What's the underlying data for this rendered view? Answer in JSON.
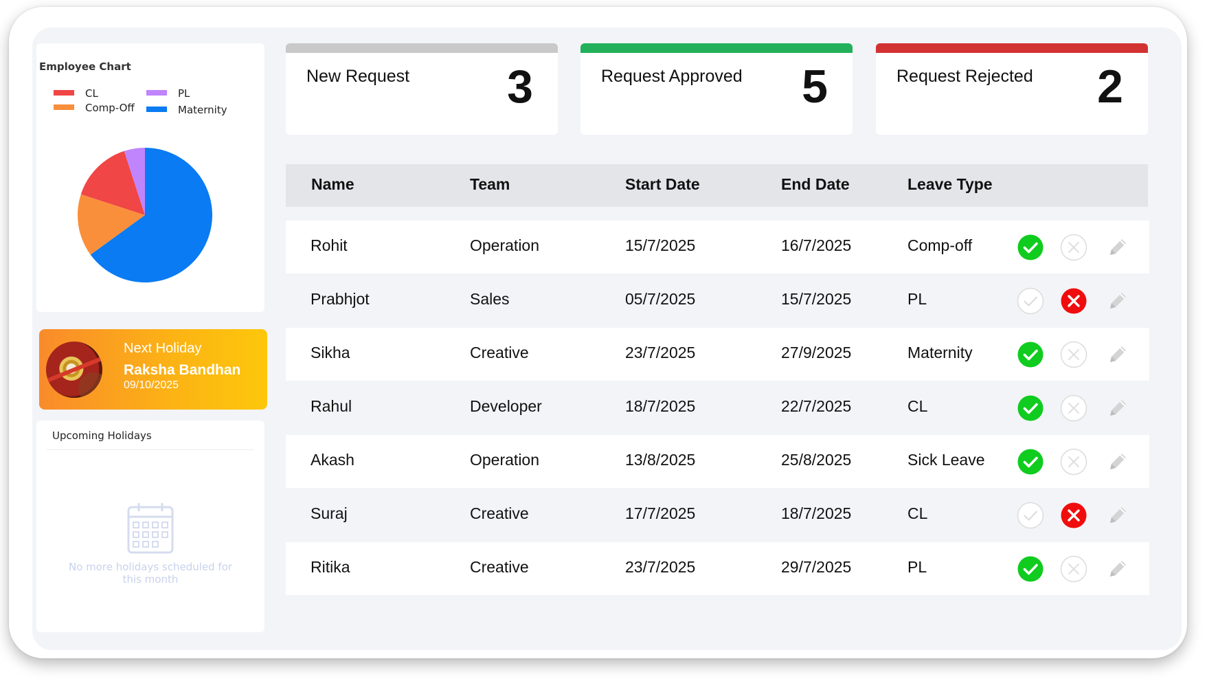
{
  "chart_card": {
    "title": "Employee Chart",
    "legend": [
      {
        "label": "CL",
        "color": "#f04646"
      },
      {
        "label": "PL",
        "color": "#c084fc"
      },
      {
        "label": "Comp-Off",
        "color": "#fa8f3b"
      },
      {
        "label": "Maternity",
        "color": "#0a7bf2"
      }
    ]
  },
  "chart_data": {
    "type": "pie",
    "title": "Employee Chart",
    "slices": [
      {
        "label": "Maternity",
        "value": 65,
        "color": "#0a7bf2"
      },
      {
        "label": "Comp-Off",
        "value": 15,
        "color": "#fa8f3b"
      },
      {
        "label": "CL",
        "value": 15,
        "color": "#f04646"
      },
      {
        "label": "PL",
        "value": 5,
        "color": "#c084fc"
      }
    ],
    "legend_position": "top"
  },
  "holiday": {
    "label": "Next Holiday",
    "name": "Raksha Bandhan",
    "date": "09/10/2025"
  },
  "upcoming": {
    "title": "Upcoming Holidays",
    "empty_message": "No more holidays scheduled for this month"
  },
  "stats": {
    "new": {
      "label": "New Request",
      "value": "3",
      "color": "#c9c9c9"
    },
    "approved": {
      "label": "Request Approved",
      "value": "5",
      "color": "#22b05a"
    },
    "rejected": {
      "label": "Request Rejected",
      "value": "2",
      "color": "#d23232"
    }
  },
  "table": {
    "headers": {
      "name": "Name",
      "team": "Team",
      "start": "Start Date",
      "end": "End Date",
      "type": "Leave Type"
    },
    "rows": [
      {
        "name": "Rohit",
        "team": "Operation",
        "start": "15/7/2025",
        "end": "16/7/2025",
        "type": "Comp-off",
        "status": "approved"
      },
      {
        "name": "Prabhjot",
        "team": "Sales",
        "start": "05/7/2025",
        "end": "15/7/2025",
        "type": "PL",
        "status": "rejected"
      },
      {
        "name": "Sikha",
        "team": "Creative",
        "start": "23/7/2025",
        "end": "27/9/2025",
        "type": "Maternity",
        "status": "approved"
      },
      {
        "name": "Rahul",
        "team": "Developer",
        "start": "18/7/2025",
        "end": "22/7/2025",
        "type": "CL",
        "status": "approved"
      },
      {
        "name": "Akash",
        "team": "Operation",
        "start": "13/8/2025",
        "end": "25/8/2025",
        "type": "Sick Leave",
        "status": "approved"
      },
      {
        "name": "Suraj",
        "team": "Creative",
        "start": "17/7/2025",
        "end": "18/7/2025",
        "type": "CL",
        "status": "rejected"
      },
      {
        "name": "Ritika",
        "team": "Creative",
        "start": "23/7/2025",
        "end": "29/7/2025",
        "type": "PL",
        "status": "approved"
      }
    ]
  },
  "icons": {
    "approve": "check-circle-icon",
    "reject": "x-circle-icon",
    "edit": "pencil-icon",
    "calendar": "calendar-icon"
  }
}
